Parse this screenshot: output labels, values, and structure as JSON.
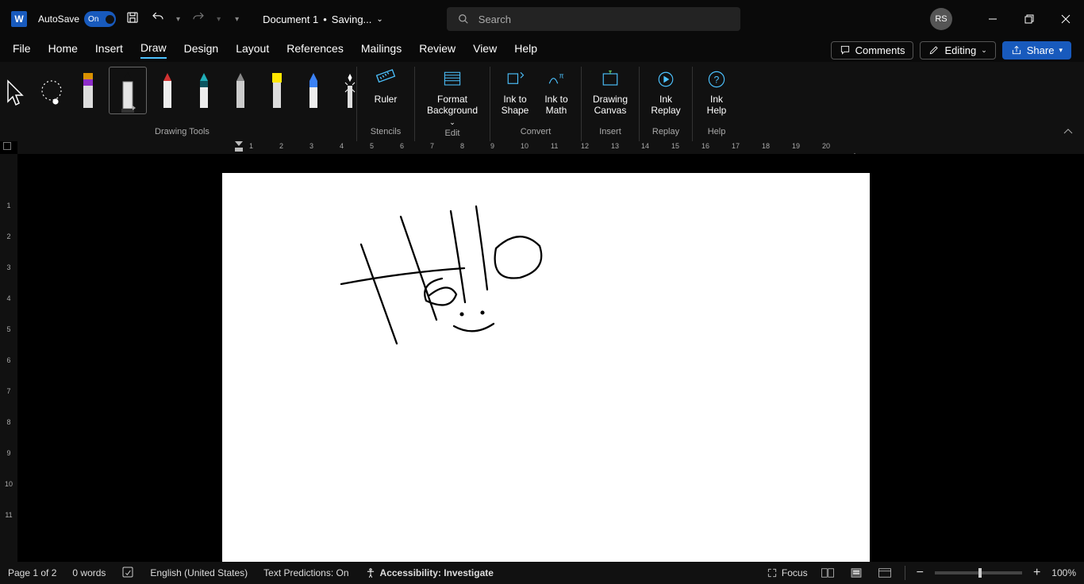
{
  "title": {
    "autosave_label": "AutoSave",
    "autosave_state": "On",
    "document_name": "Document 1",
    "save_status": "Saving...",
    "search_placeholder": "Search",
    "user_initials": "RS"
  },
  "tabs": {
    "items": [
      "File",
      "Home",
      "Insert",
      "Draw",
      "Design",
      "Layout",
      "References",
      "Mailings",
      "Review",
      "View",
      "Help"
    ],
    "active": "Draw",
    "comments": "Comments",
    "editing": "Editing",
    "share": "Share"
  },
  "ribbon": {
    "groups": {
      "drawing": "Drawing Tools",
      "stencils": "Stencils",
      "edit": "Edit",
      "convert": "Convert",
      "insert": "Insert",
      "replay": "Replay",
      "help": "Help"
    },
    "buttons": {
      "ruler": "Ruler",
      "format_bg1": "Format",
      "format_bg2": "Background",
      "ink_shape1": "Ink to",
      "ink_shape2": "Shape",
      "ink_math1": "Ink to",
      "ink_math2": "Math",
      "drawing_canvas1": "Drawing",
      "drawing_canvas2": "Canvas",
      "ink_replay1": "Ink",
      "ink_replay2": "Replay",
      "ink_help1": "Ink",
      "ink_help2": "Help"
    },
    "pens": [
      {
        "name": "select",
        "colors": []
      },
      {
        "name": "lasso",
        "colors": []
      },
      {
        "name": "eraser-pen",
        "colors": [
          "#d99100",
          "#8e2ec9"
        ]
      },
      {
        "name": "pen-black",
        "colors": [
          "#000",
          "#000"
        ],
        "selected": true
      },
      {
        "name": "pen-red",
        "colors": [
          "#d13232",
          "#d13232"
        ]
      },
      {
        "name": "pen-teal",
        "colors": [
          "#20aeb8",
          "#0b5560"
        ]
      },
      {
        "name": "pencil-grey",
        "colors": [
          "#888",
          "#888"
        ]
      },
      {
        "name": "highlighter-yellow",
        "colors": [
          "#ffe600",
          "#ffe600"
        ]
      },
      {
        "name": "pen-rainbow",
        "colors": [
          "#3b82f6",
          "#3b82f6"
        ]
      }
    ],
    "action_pen": "action"
  },
  "ruler": {
    "marks": [
      "1",
      "2",
      "3",
      "4",
      "5",
      "6",
      "7",
      "8",
      "9",
      "10",
      "11",
      "12",
      "13",
      "14",
      "15",
      "16",
      "17",
      "18",
      "19",
      "20"
    ],
    "vmarks": [
      "1",
      "2",
      "3",
      "4",
      "5",
      "6",
      "7",
      "8",
      "9",
      "10",
      "11"
    ]
  },
  "status": {
    "page": "Page 1 of 2",
    "words": "0 words",
    "language": "English (United States)",
    "predictions": "Text Predictions: On",
    "accessibility": "Accessibility: Investigate",
    "focus": "Focus",
    "zoom": "100%"
  },
  "canvas": {
    "ink_text": "Hello"
  }
}
